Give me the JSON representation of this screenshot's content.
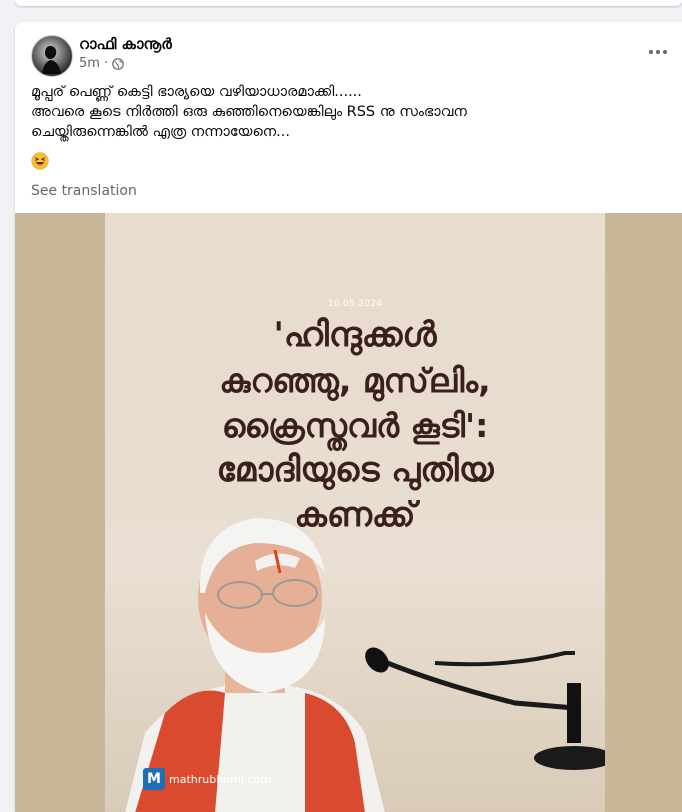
{
  "post": {
    "author": "റാഫി കാനൂർ",
    "time": "5m",
    "privacy_icon": "globe-icon",
    "text_lines": [
      "മൂപ്പര് പെണ്ണ് കെട്ടി ഭാര്യയെ വഴിയാധാരമാക്കി......",
      "അവരെ കൂടെ നിർത്തി ഒരു കുഞ്ഞിനെയെങ്കിലും RSS നു സംഭാവന",
      "ചെയ്തിരുന്നെങ്കിൽ എത്ര നന്നായേനെ..."
    ],
    "emoji": "😆",
    "see_translation": "See translation"
  },
  "image": {
    "date": "10.05.2024",
    "headline_lines": [
      "'ഹിന്ദുക്കൾ",
      "കുറഞ്ഞു, മുസ്‌ലിം,",
      "ക്രൈസ്തവർ കൂടി':",
      "മോദിയുടെ പുതിയ",
      "കണക്ക്"
    ],
    "watermark_letter": "M",
    "watermark": "mathrubhumi.com"
  }
}
